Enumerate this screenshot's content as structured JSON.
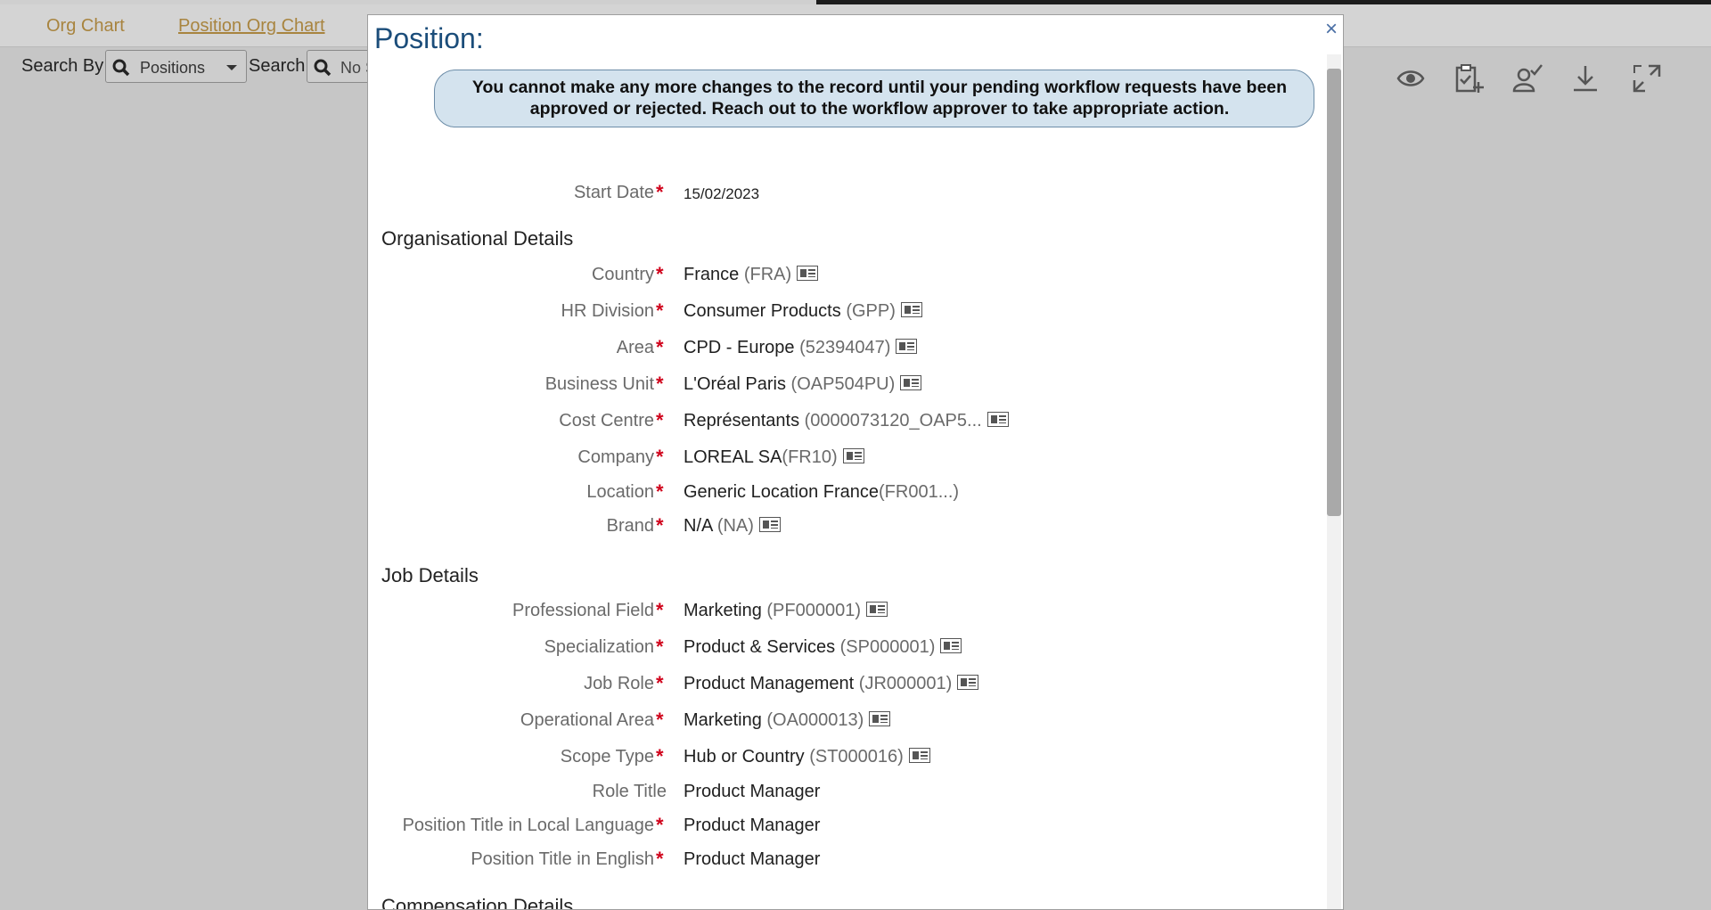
{
  "background": {
    "tabs": [
      "Org Chart",
      "Position Org Chart"
    ],
    "search_by_label": "Search By",
    "search_by_value": "Positions",
    "search_label": "Search",
    "search_value": "No Se",
    "toolbar_icons": [
      "eye-icon",
      "clipboard-add-icon",
      "user-check-icon",
      "download-icon",
      "fullscreen-icon"
    ]
  },
  "modal": {
    "title": "Position:",
    "close": "×",
    "notice": "You cannot make any more changes to the record until your pending workflow requests have been approved or rejected. Reach out to the workflow approver to take appropriate action.",
    "start_date": {
      "label": "Start Date",
      "value": "15/02/2023"
    },
    "sections": {
      "org": "Organisational Details",
      "job": "Job Details",
      "comp": "Compensation Details"
    },
    "org_fields": [
      {
        "label": "Country",
        "value": "France",
        "code": "(FRA)"
      },
      {
        "label": "HR Division",
        "value": "Consumer Products",
        "code": "(GPP)"
      },
      {
        "label": "Area",
        "value": "CPD - Europe",
        "code": "(52394047)"
      },
      {
        "label": "Business Unit",
        "value": "L'Oréal Paris",
        "code": "(OAP504PU)"
      },
      {
        "label": "Cost Centre",
        "value": "Représentants",
        "code": "(0000073120_OAP5..."
      },
      {
        "label": "Company",
        "value": "LOREAL SA",
        "code": "(FR10)"
      },
      {
        "label": "Location",
        "value": "Generic Location France",
        "code": "(FR001...)"
      },
      {
        "label": "Brand",
        "value": "N/A",
        "code": "(NA)"
      }
    ],
    "job_fields": [
      {
        "label": "Professional Field",
        "value": "Marketing",
        "code": "(PF000001)"
      },
      {
        "label": "Specialization",
        "value": "Product & Services",
        "code": "(SP000001)"
      },
      {
        "label": "Job Role",
        "value": "Product Management",
        "code": "(JR000001)"
      },
      {
        "label": "Operational Area",
        "value": "Marketing",
        "code": "(OA000013)"
      },
      {
        "label": "Scope Type",
        "value": "Hub or Country",
        "code": "(ST000016)"
      },
      {
        "label": "Role Title",
        "value": "Product Manager"
      },
      {
        "label": "Position Title in Local Language",
        "value": "Product Manager"
      },
      {
        "label": "Position Title in English",
        "value": "Product Manager"
      }
    ],
    "required_marker": "*"
  }
}
